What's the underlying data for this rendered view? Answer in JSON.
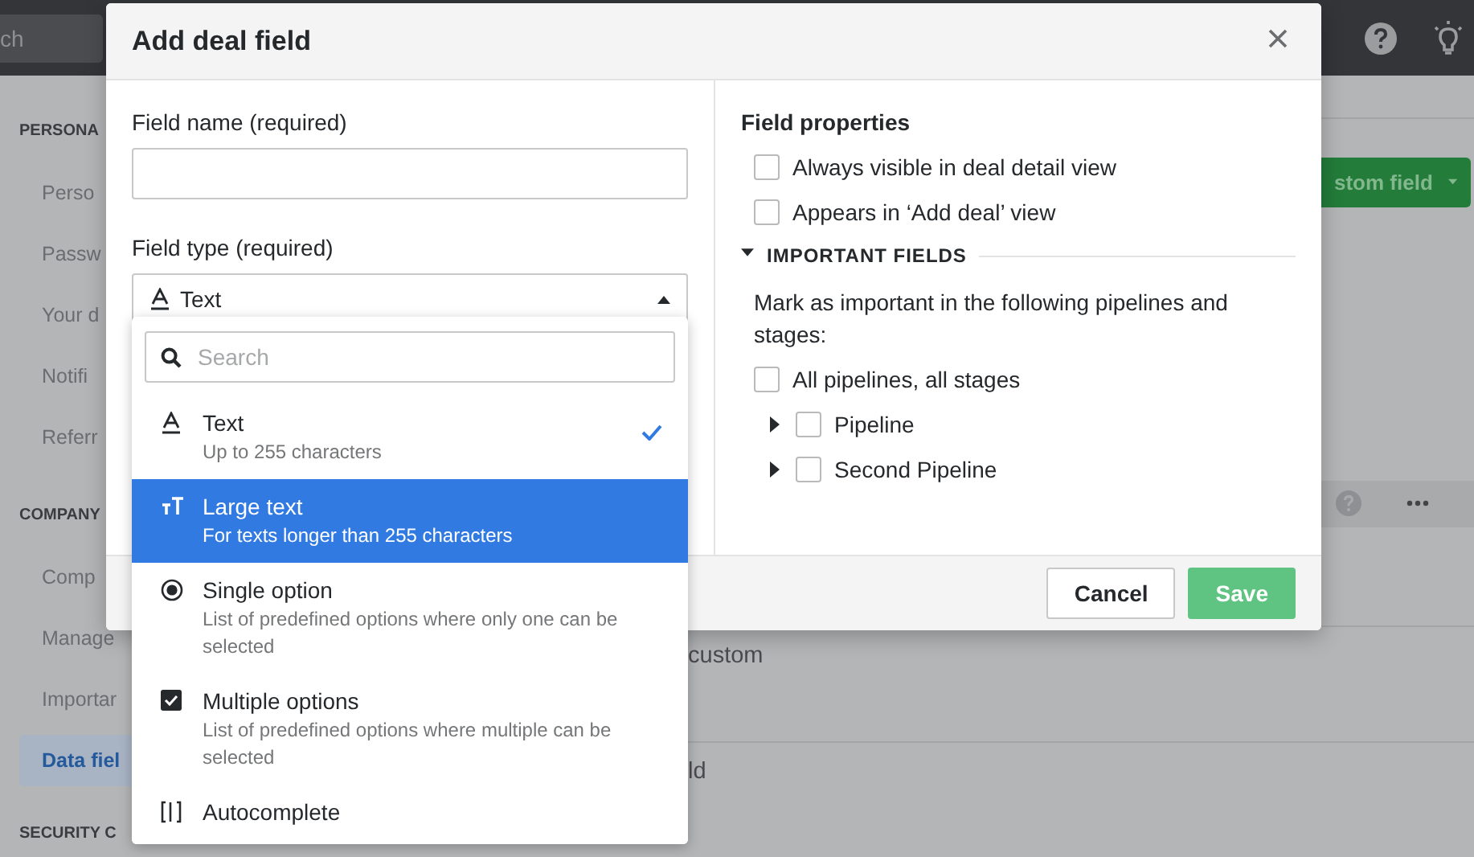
{
  "top_bar": {
    "search": {
      "placeholder": "ch"
    }
  },
  "sidebar": {
    "sections": [
      {
        "title": "PERSONA",
        "items": [
          {
            "label": "Perso",
            "selected": false
          },
          {
            "label": "Passw",
            "selected": false
          },
          {
            "label": "Your d",
            "selected": false
          },
          {
            "label": "Notifi",
            "selected": false
          },
          {
            "label": "Referr",
            "selected": false
          }
        ]
      },
      {
        "title": "COMPANY",
        "items": [
          {
            "label": "Comp",
            "selected": false
          },
          {
            "label": "Manage",
            "selected": false
          },
          {
            "label": "Importar",
            "selected": false
          },
          {
            "label": "Data fiel",
            "selected": true
          }
        ]
      },
      {
        "title": "SECURITY C"
      }
    ]
  },
  "main": {
    "add_button": {
      "label": "stom field"
    },
    "rows": [
      {
        "text": "custom"
      },
      {
        "text": "ld"
      }
    ]
  },
  "dialog": {
    "title": "Add deal field",
    "field_name": {
      "label": "Field name (required)"
    },
    "field_type": {
      "label": "Field type (required)",
      "value": "Text",
      "expanded": true
    },
    "dropdown": {
      "search": {
        "placeholder": "Search"
      },
      "options": [
        {
          "kind": "text",
          "label": "Text",
          "description": "Up to 255 characters",
          "selected": true,
          "highlighted": false
        },
        {
          "kind": "large-text",
          "label": "Large text",
          "description": "For texts longer than 255 characters",
          "selected": false,
          "highlighted": true
        },
        {
          "kind": "single",
          "label": "Single option",
          "description": "List of predefined options where only one can be selected",
          "selected": false,
          "highlighted": false
        },
        {
          "kind": "multiple",
          "label": "Multiple options",
          "description": "List of predefined options where multiple can be selected",
          "selected": false,
          "highlighted": false
        },
        {
          "kind": "autocomplete",
          "label": "Autocomplete",
          "selected": false,
          "highlighted": false
        }
      ]
    },
    "properties": {
      "title": "Field properties",
      "options": [
        {
          "label": "Always visible in deal detail view",
          "checked": false
        },
        {
          "label": "Appears in ‘Add deal’ view",
          "checked": false
        }
      ]
    },
    "important": {
      "title": "IMPORTANT FIELDS",
      "expanded": true,
      "text": "Mark as important in the following pipelines and stages:",
      "all": {
        "label": "All pipelines, all stages",
        "checked": false
      },
      "children": [
        {
          "label": "Pipeline",
          "checked": false,
          "expanded": false
        },
        {
          "label": "Second Pipeline",
          "checked": false,
          "expanded": false
        }
      ]
    },
    "buttons": [
      {
        "kind": "cancel",
        "label": "Cancel"
      },
      {
        "kind": "save",
        "label": "Save"
      }
    ]
  }
}
